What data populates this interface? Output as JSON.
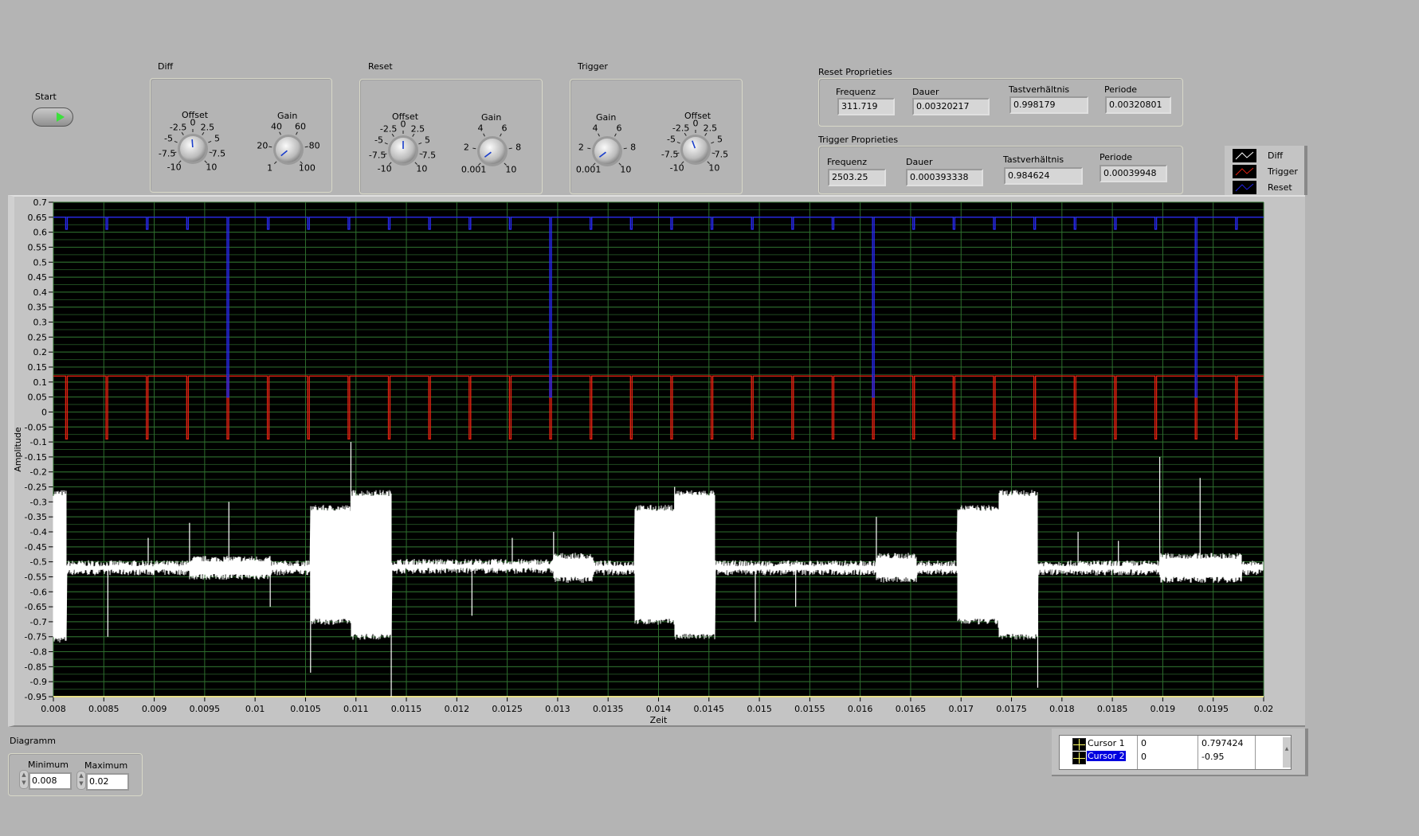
{
  "start": {
    "label": "Start",
    "state": "on"
  },
  "diff_group": {
    "title": "Diff",
    "offset": {
      "label": "Offset",
      "scale": [
        "-10",
        "-7.5",
        "-5",
        "-2.5",
        "0",
        "2.5",
        "5",
        "7.5",
        "10"
      ],
      "value": -0.3,
      "min": -10,
      "max": 10
    },
    "gain": {
      "label": "Gain",
      "scale": [
        "1",
        "20",
        "40",
        "60",
        "80",
        "100"
      ],
      "value": 3,
      "min": 1,
      "max": 100
    }
  },
  "reset_group": {
    "title": "Reset",
    "offset": {
      "label": "Offset",
      "scale": [
        "-10",
        "-7.5",
        "-5",
        "-2.5",
        "0",
        "2.5",
        "5",
        "7.5",
        "10"
      ],
      "value": 0,
      "min": -10,
      "max": 10
    },
    "gain": {
      "label": "Gain",
      "scale": [
        "0.001",
        "2",
        "4",
        "6",
        "8",
        "10"
      ],
      "value": 0.3,
      "min": 0.001,
      "max": 10
    }
  },
  "trigger_group": {
    "title": "Trigger",
    "gain": {
      "label": "Gain",
      "scale": [
        "0.001",
        "2",
        "4",
        "6",
        "8",
        "10"
      ],
      "value": 0.3,
      "min": 0.001,
      "max": 10
    },
    "offset": {
      "label": "Offset",
      "scale": [
        "-10",
        "-7.5",
        "-5",
        "-2.5",
        "0",
        "2.5",
        "5",
        "7.5",
        "10"
      ],
      "value": -1.5,
      "min": -10,
      "max": 10
    }
  },
  "reset_props": {
    "title": "Reset Proprieties",
    "frequenz_label": "Frequenz",
    "frequenz": "311.719",
    "dauer_label": "Dauer",
    "dauer": "0.00320217",
    "tast_label": "Tastverhältnis",
    "tast": "0.998179",
    "periode_label": "Periode",
    "periode": "0.00320801"
  },
  "trigger_props": {
    "title": "Trigger Proprieties",
    "frequenz_label": "Frequenz",
    "frequenz": "2503.25",
    "dauer_label": "Dauer",
    "dauer": "0.000393338",
    "tast_label": "Tastverhältnis",
    "tast": "0.984624",
    "periode_label": "Periode",
    "periode": "0.00039948"
  },
  "legend": [
    {
      "name": "Diff",
      "color": "#ffffff"
    },
    {
      "name": "Trigger",
      "color": "#e02010"
    },
    {
      "name": "Reset",
      "color": "#2020e0"
    }
  ],
  "diagramm": {
    "title": "Diagramm",
    "min_label": "Minimum",
    "min": "0.008",
    "max_label": "Maximum",
    "max": "0.02"
  },
  "cursors": [
    {
      "name": "Cursor 1",
      "x": "0",
      "y": "0.797424",
      "selected": false
    },
    {
      "name": "Cursor 2",
      "x": "0",
      "y": "-0.95",
      "selected": true
    }
  ],
  "chart_data": {
    "type": "line",
    "xlabel": "Zeit",
    "ylabel": "Amplitude",
    "xlim": [
      0.008,
      0.02
    ],
    "ylim": [
      -0.95,
      0.7
    ],
    "grid": true,
    "legend_position": "top-right",
    "xticks": [
      "0.008",
      "0.0085",
      "0.009",
      "0.0095",
      "0.01",
      "0.0105",
      "0.011",
      "0.0115",
      "0.012",
      "0.0125",
      "0.013",
      "0.0135",
      "0.014",
      "0.0145",
      "0.015",
      "0.0155",
      "0.016",
      "0.0165",
      "0.017",
      "0.0175",
      "0.018",
      "0.0185",
      "0.019",
      "0.0195",
      "0.02"
    ],
    "yticks": [
      "0.7",
      "0.65",
      "0.6",
      "0.55",
      "0.5",
      "0.45",
      "0.4",
      "0.35",
      "0.3",
      "0.25",
      "0.2",
      "0.15",
      "0.1",
      "0.05",
      "0",
      "-0.05",
      "-0.1",
      "-0.15",
      "-0.2",
      "-0.25",
      "-0.3",
      "-0.35",
      "-0.4",
      "-0.45",
      "-0.5",
      "-0.55",
      "-0.6",
      "-0.65",
      "-0.7",
      "-0.75",
      "-0.8",
      "-0.85",
      "-0.9",
      "-0.95"
    ],
    "series": [
      {
        "name": "Reset",
        "baseline": 0.65,
        "small_dip_to": 0.61,
        "small_dip_start": 0.00813,
        "small_dip_period": 0.0004,
        "large_dips": [
          [
            0.00974,
            0.05
          ],
          [
            0.01296,
            0.05
          ],
          [
            0.01616,
            0.05
          ],
          [
            0.01937,
            0.05
          ]
        ]
      },
      {
        "name": "Trigger",
        "baseline": 0.12,
        "dip_to": -0.09,
        "first_dip": 0.00813,
        "period": 0.0004,
        "count": 30
      },
      {
        "name": "Diff",
        "baseline": -0.52,
        "segments": [
          [
            0.008,
            0.00813,
            -0.27,
            -0.76
          ],
          [
            0.00935,
            0.01015,
            -0.49,
            -0.55
          ],
          [
            0.01055,
            0.01095,
            -0.32,
            -0.7
          ],
          [
            0.01095,
            0.01135,
            -0.27,
            -0.75
          ],
          [
            0.01135,
            0.01296,
            -0.5,
            -0.53
          ],
          [
            0.01296,
            0.01335,
            -0.48,
            -0.56
          ],
          [
            0.01376,
            0.01416,
            -0.32,
            -0.7
          ],
          [
            0.01416,
            0.01456,
            -0.27,
            -0.75
          ],
          [
            0.01616,
            0.01656,
            -0.48,
            -0.56
          ],
          [
            0.01696,
            0.01737,
            -0.32,
            -0.7
          ],
          [
            0.01737,
            0.01776,
            -0.27,
            -0.75
          ],
          [
            0.01897,
            0.01978,
            -0.48,
            -0.56
          ]
        ],
        "spikes": [
          [
            0.00854,
            -0.75
          ],
          [
            0.00894,
            -0.42
          ],
          [
            0.00935,
            -0.37
          ],
          [
            0.00974,
            -0.3
          ],
          [
            0.01015,
            -0.65
          ],
          [
            0.01055,
            -0.87
          ],
          [
            0.01095,
            -0.1
          ],
          [
            0.01135,
            -0.95
          ],
          [
            0.01215,
            -0.68
          ],
          [
            0.01255,
            -0.42
          ],
          [
            0.01296,
            -0.4
          ],
          [
            0.01416,
            -0.25
          ],
          [
            0.01496,
            -0.7
          ],
          [
            0.01536,
            -0.65
          ],
          [
            0.01616,
            -0.35
          ],
          [
            0.01696,
            -0.4
          ],
          [
            0.01737,
            -0.72
          ],
          [
            0.01776,
            -0.92
          ],
          [
            0.01816,
            -0.4
          ],
          [
            0.01856,
            -0.43
          ],
          [
            0.01897,
            -0.15
          ],
          [
            0.01937,
            -0.22
          ]
        ]
      }
    ]
  }
}
